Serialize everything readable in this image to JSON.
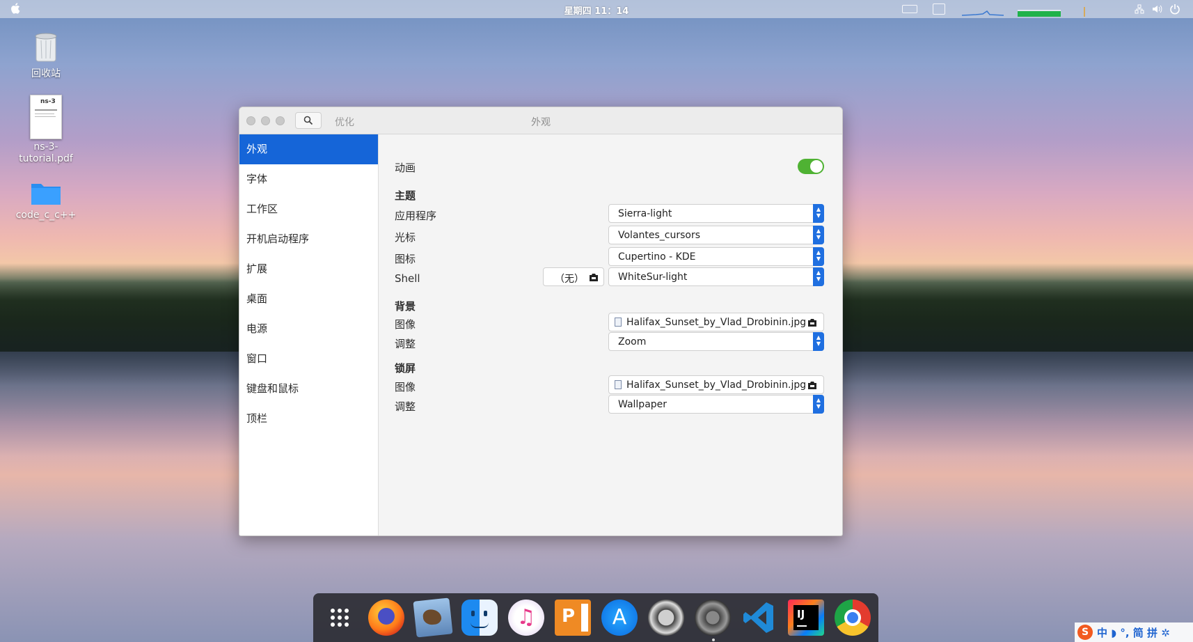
{
  "topbar": {
    "clock": "星期四 11：14"
  },
  "desktop": {
    "icons": [
      {
        "label": "回收站"
      },
      {
        "label": "ns-3-\ntutorial.pdf",
        "line1": "ns-3-",
        "line2": "tutorial.pdf",
        "thumb_text": "ns-3"
      },
      {
        "label": "code_c_c++"
      }
    ]
  },
  "window": {
    "left_title": "优化",
    "title": "外观",
    "sidebar": {
      "items": [
        {
          "label": "外观",
          "active": true
        },
        {
          "label": "字体"
        },
        {
          "label": "工作区"
        },
        {
          "label": "开机启动程序"
        },
        {
          "label": "扩展"
        },
        {
          "label": "桌面"
        },
        {
          "label": "电源"
        },
        {
          "label": "窗口"
        },
        {
          "label": "键盘和鼠标"
        },
        {
          "label": "顶栏"
        }
      ]
    },
    "appearance": {
      "animation_label": "动画",
      "animation_on": true,
      "theme_header": "主题",
      "applications_label": "应用程序",
      "applications_value": "Sierra-light",
      "cursor_label": "光标",
      "cursor_value": "Volantes_cursors",
      "icons_label": "图标",
      "icons_value": "Cupertino - KDE",
      "shell_label": "Shell",
      "shell_file": "（无）",
      "shell_value": "WhiteSur-light",
      "background_header": "背景",
      "bg_image_label": "图像",
      "bg_image_value": "Halifax_Sunset_by_Vlad_Drobinin.jpg",
      "bg_adjust_label": "调整",
      "bg_adjust_value": "Zoom",
      "lock_header": "锁屏",
      "lock_image_label": "图像",
      "lock_image_value": "Halifax_Sunset_by_Vlad_Drobinin.jpg",
      "lock_adjust_label": "调整",
      "lock_adjust_value": "Wallpaper"
    }
  },
  "dock": {
    "apps": [
      "app-grid",
      "firefox",
      "preview",
      "finder",
      "music",
      "presentation",
      "app-store",
      "screenshot",
      "system-settings",
      "vscode",
      "intellij",
      "chrome"
    ]
  },
  "ime": {
    "text": "中 ◗ °, 简 拼 ✲"
  },
  "colors": {
    "accent": "#1565d8",
    "switch_on": "#4fb233"
  }
}
